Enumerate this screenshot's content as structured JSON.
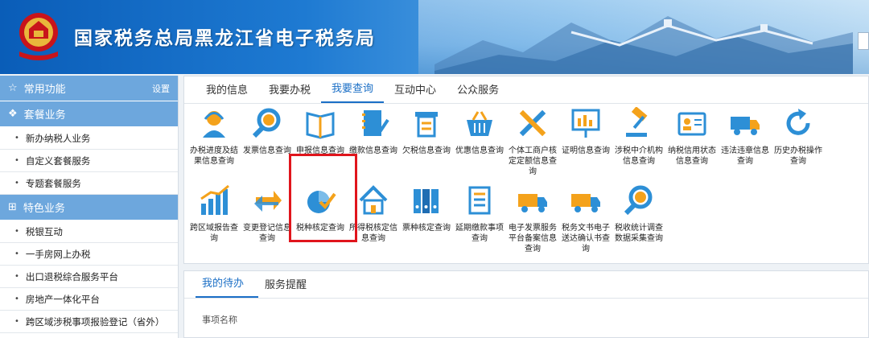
{
  "header": {
    "title": "国家税务总局黑龙江省电子税务局"
  },
  "sidebar": {
    "common": {
      "label": "常用功能",
      "action": "设置"
    },
    "package": {
      "label": "套餐业务"
    },
    "package_items": [
      "新办纳税人业务",
      "自定义套餐服务",
      "专题套餐服务"
    ],
    "special": {
      "label": "特色业务"
    },
    "special_items": [
      "税银互动",
      "一手房网上办税",
      "出口退税综合服务平台",
      "房地产一体化平台",
      "跨区域涉税事项报验登记（省外）"
    ]
  },
  "main": {
    "tabs": [
      "我的信息",
      "我要办税",
      "我要查询",
      "互动中心",
      "公众服务"
    ],
    "active_tab": "我要查询",
    "functions": [
      {
        "label": "办税进度及结果信息查询",
        "icon": "headset-user-icon"
      },
      {
        "label": "发票信息查询",
        "icon": "magnifier-icon"
      },
      {
        "label": "申报信息查询",
        "icon": "open-book-icon"
      },
      {
        "label": "缴款信息查询",
        "icon": "notebook-check-icon"
      },
      {
        "label": "欠税信息查询",
        "icon": "receipt-icon"
      },
      {
        "label": "优惠信息查询",
        "icon": "shopping-basket-icon"
      },
      {
        "label": "个体工商户核定定额信息查询",
        "icon": "tools-icon"
      },
      {
        "label": "证明信息查询",
        "icon": "presentation-board-icon"
      },
      {
        "label": "涉税中介机构信息查询",
        "icon": "gavel-icon"
      },
      {
        "label": "纳税信用状态信息查询",
        "icon": "id-card-icon"
      },
      {
        "label": "违法违章信息查询",
        "icon": "truck-icon"
      },
      {
        "label": "历史办税操作查询",
        "icon": "refresh-icon"
      },
      {
        "label": "跨区域报告查询",
        "icon": "bar-chart-icon"
      },
      {
        "label": "变更登记信息查询",
        "icon": "swap-arrows-icon"
      },
      {
        "label": "税种核定查询",
        "icon": "pie-check-icon"
      },
      {
        "label": "所得税核定信息查询",
        "icon": "house-icon"
      },
      {
        "label": "票种核定查询",
        "icon": "binders-icon"
      },
      {
        "label": "延期缴款事项查询",
        "icon": "document-list-icon"
      },
      {
        "label": "电子发票服务平台备案信息查询",
        "icon": "delivery-truck-icon"
      },
      {
        "label": "税务文书电子送达确认书查询",
        "icon": "delivery-truck-2-icon"
      },
      {
        "label": "税收统计调查数据采集查询",
        "icon": "search-stats-icon"
      }
    ],
    "highlighted": "税种核定查询"
  },
  "lower": {
    "tabs": [
      "我的待办",
      "服务提醒"
    ],
    "active_tab": "我的待办",
    "column": "事项名称"
  },
  "colors": {
    "accent": "#1b6fc6",
    "sidebar_head": "#6da7dd",
    "highlight": "#e0151c",
    "icon_blue": "#2d8fd6",
    "icon_orange": "#f4a21b"
  }
}
